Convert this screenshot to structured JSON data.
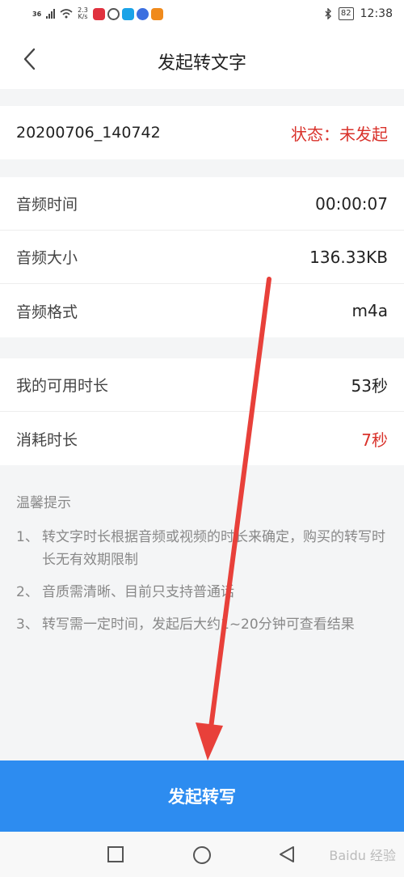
{
  "status_bar": {
    "network": "36",
    "speed_value": "2.3",
    "speed_unit": "K/s",
    "battery": "82",
    "time": "12:38"
  },
  "header": {
    "title": "发起转文字"
  },
  "file": {
    "name": "20200706_140742",
    "status": "状态：未发起"
  },
  "audio_info": [
    {
      "label": "音频时间",
      "value": "00:00:07"
    },
    {
      "label": "音频大小",
      "value": "136.33KB"
    },
    {
      "label": "音频格式",
      "value": "m4a"
    }
  ],
  "duration_info": [
    {
      "label": "我的可用时长",
      "value": "53秒"
    },
    {
      "label": "消耗时长",
      "value": "7秒"
    }
  ],
  "tips": {
    "title": "温馨提示",
    "items": [
      {
        "num": "1、",
        "text": "转文字时长根据音频或视频的时长来确定，购买的转写时长无有效期限制"
      },
      {
        "num": "2、",
        "text": "音质需清晰、目前只支持普通话"
      },
      {
        "num": "3、",
        "text": "转写需一定时间，发起后大约1~20分钟可查看结果"
      }
    ]
  },
  "submit_label": "发起转写",
  "watermark": "Baidu 经验",
  "colors": {
    "accent": "#2d8cf0",
    "status_red": "#d9322b",
    "annotation_arrow": "#e8403a"
  }
}
